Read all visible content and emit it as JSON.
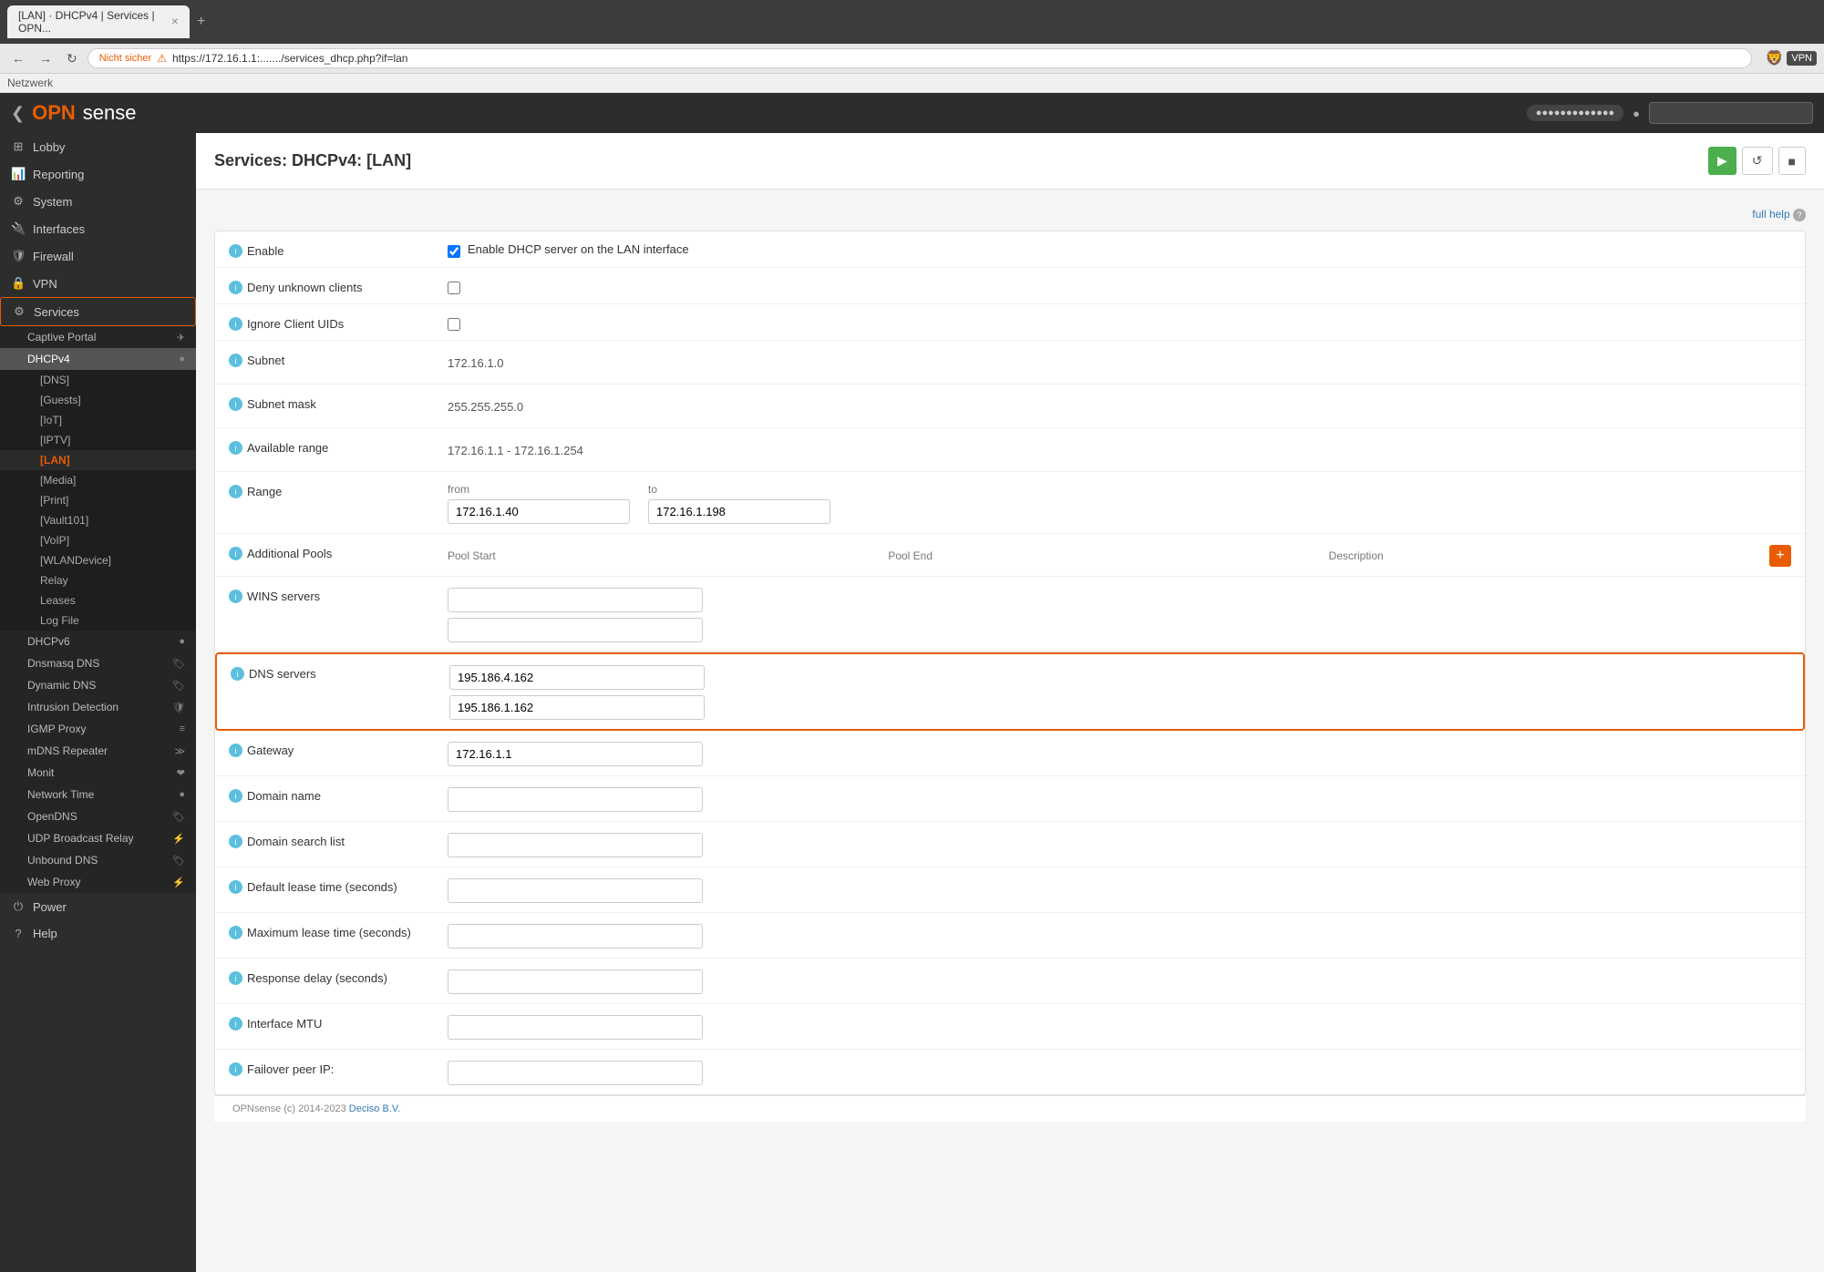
{
  "browser": {
    "tab_title": "[LAN] · DHCPv4 | Services | OPN...",
    "address_warning": "Nicht sicher",
    "address_url": "https://172.16.1.1:......./services_dhcp.php?if=lan",
    "bookmarks_label": "Netzwerk"
  },
  "topbar": {
    "logo_x": "OPN",
    "logo_sense": "sense",
    "collapse_label": "❮",
    "search_placeholder": ""
  },
  "sidebar": {
    "items": [
      {
        "id": "lobby",
        "label": "Lobby",
        "icon": "⊞"
      },
      {
        "id": "reporting",
        "label": "Reporting",
        "icon": "📊"
      },
      {
        "id": "system",
        "label": "System",
        "icon": "⚙"
      },
      {
        "id": "interfaces",
        "label": "Interfaces",
        "icon": "🔌"
      },
      {
        "id": "firewall",
        "label": "Firewall",
        "icon": "🛡"
      },
      {
        "id": "vpn",
        "label": "VPN",
        "icon": "🔒"
      },
      {
        "id": "services",
        "label": "Services",
        "icon": "⚙",
        "active": true
      }
    ],
    "services_subitems": [
      {
        "id": "captive-portal",
        "label": "Captive Portal",
        "icon": "✈",
        "has_icon": true
      },
      {
        "id": "dhcpv4",
        "label": "DHCPv4",
        "icon": "●",
        "active": true,
        "has_icon": true
      },
      {
        "id": "dhcpv6",
        "label": "DHCPv6",
        "has_icon": true
      },
      {
        "id": "dnsmasq-dns",
        "label": "Dnsmasq DNS",
        "has_icon": true
      },
      {
        "id": "dynamic-dns",
        "label": "Dynamic DNS",
        "has_icon": true
      },
      {
        "id": "intrusion-detection",
        "label": "Intrusion Detection",
        "has_icon": true
      },
      {
        "id": "igmp-proxy",
        "label": "IGMP Proxy",
        "has_icon": true
      },
      {
        "id": "mdns-repeater",
        "label": "mDNS Repeater",
        "has_icon": true
      },
      {
        "id": "monit",
        "label": "Monit",
        "has_icon": true
      },
      {
        "id": "network-time",
        "label": "Network Time",
        "has_icon": true
      },
      {
        "id": "opendns",
        "label": "OpenDNS",
        "has_icon": true
      },
      {
        "id": "udp-broadcast-relay",
        "label": "UDP Broadcast Relay",
        "has_icon": true
      },
      {
        "id": "unbound-dns",
        "label": "Unbound DNS",
        "has_icon": true
      },
      {
        "id": "web-proxy",
        "label": "Web Proxy",
        "has_icon": true
      }
    ],
    "dhcpv4_subitems": [
      {
        "id": "dns",
        "label": "[DNS]"
      },
      {
        "id": "guests",
        "label": "[Guests]"
      },
      {
        "id": "iot",
        "label": "[IoT]"
      },
      {
        "id": "iptv",
        "label": "[IPTV]"
      },
      {
        "id": "lan",
        "label": "[LAN]",
        "active": true
      },
      {
        "id": "media",
        "label": "[Media]"
      },
      {
        "id": "print",
        "label": "[Print]"
      },
      {
        "id": "vault101",
        "label": "[Vault101]"
      },
      {
        "id": "voip",
        "label": "[VoIP]"
      },
      {
        "id": "wlandevice",
        "label": "[WLANDevice]"
      },
      {
        "id": "relay",
        "label": "Relay"
      },
      {
        "id": "leases",
        "label": "Leases"
      },
      {
        "id": "log-file",
        "label": "Log File"
      }
    ],
    "power": {
      "label": "Power",
      "icon": "⏻"
    },
    "help": {
      "label": "Help",
      "icon": "?"
    }
  },
  "page": {
    "title": "Services: DHCPv4: [LAN]",
    "full_help": "full help",
    "actions": {
      "start": "▶",
      "refresh": "↺",
      "stop": "■"
    }
  },
  "form": {
    "enable_label": "Enable",
    "enable_checkbox_label": "Enable DHCP server on the LAN interface",
    "deny_unknown_label": "Deny unknown clients",
    "ignore_client_uids_label": "Ignore Client UIDs",
    "subnet_label": "Subnet",
    "subnet_value": "172.16.1.0",
    "subnet_mask_label": "Subnet mask",
    "subnet_mask_value": "255.255.255.0",
    "available_range_label": "Available range",
    "available_range_value": "172.16.1.1 - 172.16.1.254",
    "range_label": "Range",
    "range_from_label": "from",
    "range_from_value": "172.16.1.40",
    "range_to_label": "to",
    "range_to_value": "172.16.1.198",
    "additional_pools_label": "Additional Pools",
    "pool_start_col": "Pool Start",
    "pool_end_col": "Pool End",
    "description_col": "Description",
    "wins_servers_label": "WINS servers",
    "wins_value1": "",
    "wins_value2": "",
    "dns_servers_label": "DNS servers",
    "dns_value1": "195.186.4.162",
    "dns_value2": "195.186.1.162",
    "gateway_label": "Gateway",
    "gateway_value": "172.16.1.1",
    "domain_name_label": "Domain name",
    "domain_name_value": "",
    "domain_search_list_label": "Domain search list",
    "domain_search_list_value": "",
    "default_lease_label": "Default lease time (seconds)",
    "default_lease_value": "",
    "max_lease_label": "Maximum lease time (seconds)",
    "max_lease_value": "",
    "response_delay_label": "Response delay (seconds)",
    "response_delay_value": "",
    "interface_mtu_label": "Interface MTU",
    "interface_mtu_value": "",
    "failover_peer_label": "Failover peer IP:",
    "failover_peer_value": ""
  },
  "footer": {
    "text": "OPNsense (c) 2014-2023 Deciso B.V."
  }
}
